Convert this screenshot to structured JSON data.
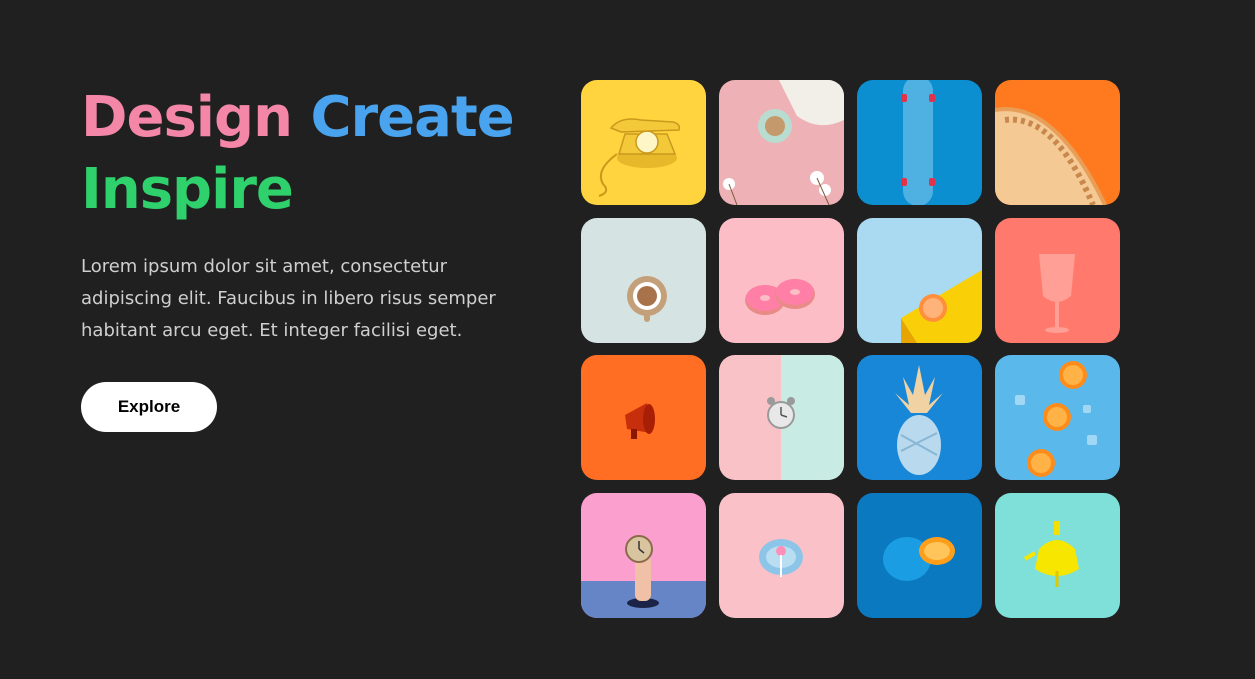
{
  "hero": {
    "headline": {
      "word1": "Design",
      "word2": "Create",
      "word3": "Inspire"
    },
    "description": "Lorem ipsum dolor sit amet, consectetur adipiscing elit. Faucibus in libero risus semper habitant arcu eget. Et integer facilisi eget.",
    "cta_label": "Explore"
  },
  "colors": {
    "background": "#202020",
    "word1": "#f486a8",
    "word2": "#4aa3ee",
    "word3": "#2fd16d",
    "cta_bg": "#ffffff"
  },
  "gallery": {
    "tiles": [
      {
        "subject": "yellow-rotary-telephone-icon",
        "bg": "#ffd43f"
      },
      {
        "subject": "coffee-cup-and-flowers-icon",
        "bg": "#eeb1b6"
      },
      {
        "subject": "longboard-skateboard-icon",
        "bg": "#0b8fd0"
      },
      {
        "subject": "orange-chair-detail-icon",
        "bg": "#ff7a1f"
      },
      {
        "subject": "coffee-cup-topview-icon",
        "bg": "#d6e3e3"
      },
      {
        "subject": "pink-donuts-icon",
        "bg": "#fdbdc6"
      },
      {
        "subject": "grapefruit-on-yellow-block-icon",
        "bg": "#a9daf2"
      },
      {
        "subject": "pink-wine-glass-icon",
        "bg": "#ff7a6c"
      },
      {
        "subject": "red-megaphone-icon",
        "bg": "#ff6e22"
      },
      {
        "subject": "alarm-clock-icon",
        "bg": "#f8c2c6"
      },
      {
        "subject": "painted-pineapple-icon",
        "bg": "#1887d8"
      },
      {
        "subject": "orange-slices-on-ice-icon",
        "bg": "#5ab8ea"
      },
      {
        "subject": "hand-holding-clock-icon",
        "bg": "#fb9fcf"
      },
      {
        "subject": "lollipop-in-dish-icon",
        "bg": "#fbc1c8"
      },
      {
        "subject": "blue-orange-half-icon",
        "bg": "#0a79bf"
      },
      {
        "subject": "yellow-teapot-icon",
        "bg": "#7fe0d9"
      }
    ]
  }
}
